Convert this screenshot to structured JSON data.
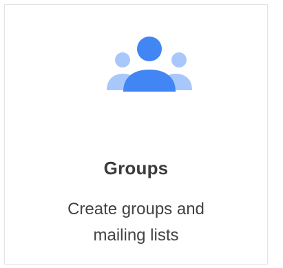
{
  "card": {
    "title": "Groups",
    "description_lines": [
      "Create groups and",
      "mailing lists"
    ],
    "icon": "people-group-icon"
  },
  "colors": {
    "primary_blue": "#4285f4",
    "light_blue": "#a8c7fa",
    "title_text": "#3c3c3c",
    "body_text": "#424242",
    "border": "#e3e3e3"
  }
}
